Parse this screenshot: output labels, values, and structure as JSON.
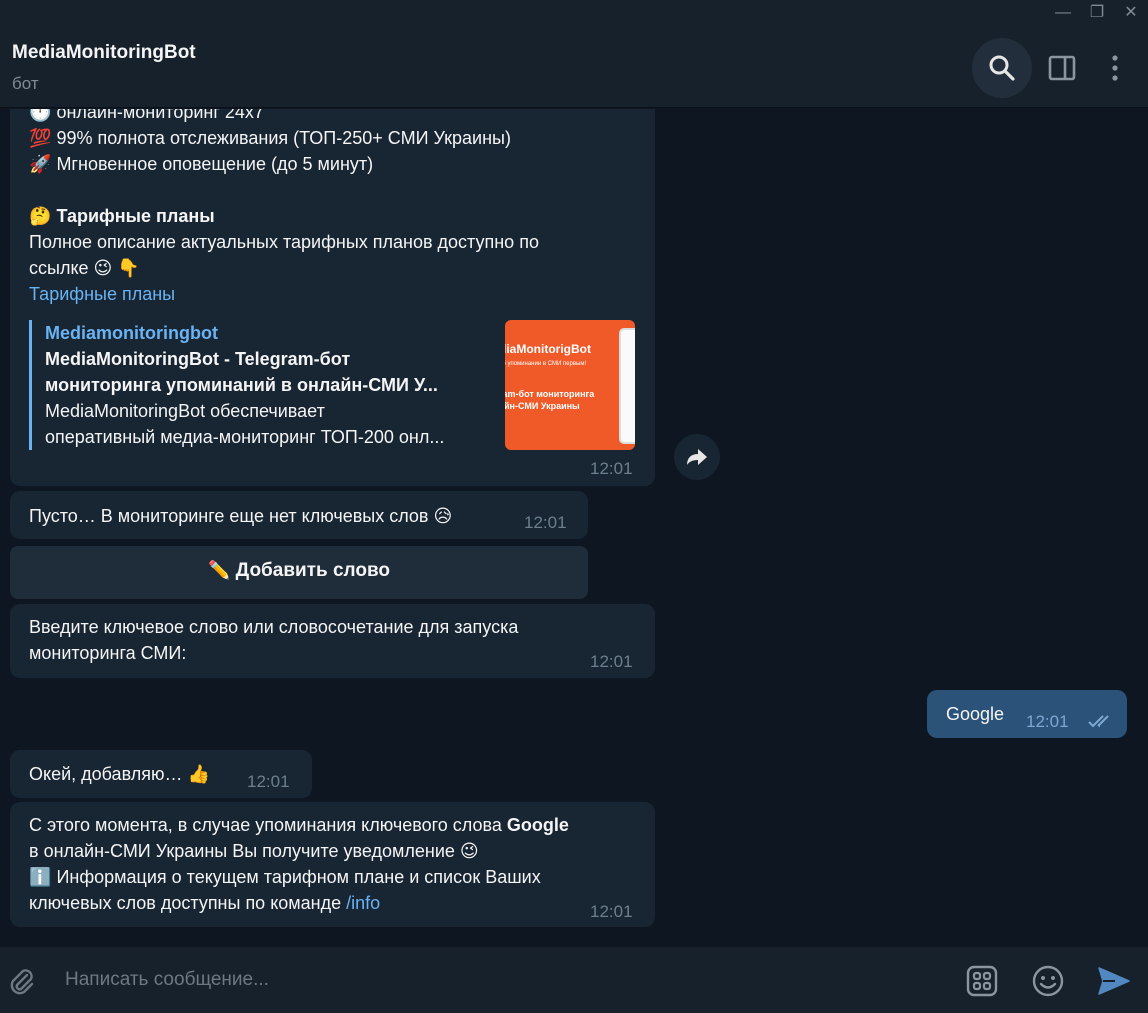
{
  "window": {
    "minimize_glyph": "—",
    "restore_glyph": "❐",
    "close_glyph": "✕"
  },
  "header": {
    "title": "MediaMonitoringBot",
    "subtitle": "бот",
    "icons": [
      "search-icon",
      "sidebar-toggle-icon",
      "more-vertical-icon"
    ]
  },
  "messages": {
    "m1": {
      "emoji_clock": "🕛",
      "line_partial": "онлайн-мониторинг 24x7",
      "emoji_100": "💯",
      "line_coverage": "99% полнота отслеживания (ТОП-250+ СМИ Украины)",
      "emoji_rocket": "🚀",
      "line_alert": "Мгновенное оповещение (до 5 минут)",
      "emoji_think": "🤔",
      "plans_heading": "Тарифные планы",
      "plans_desc_1": "Полное описание актуальных тарифных планов доступно по",
      "plans_desc_2": "ссылке",
      "emoji_wink": "😉",
      "emoji_point": "👇",
      "plans_link": "Тарифные планы",
      "preview": {
        "site": "Mediamonitoringbot",
        "title_1": "MediaMonitoringBot - Telegram-бот",
        "title_2": "мониторинга упоминаний  в онлайн-СМИ У...",
        "desc_1": "MediaMonitoringBot обеспечивает",
        "desc_2": "оперативный медиа-мониторинг ТОП-200 онл...",
        "image_text_1": "diaMonitorigBot",
        "image_text_2": "об упоминании в СМИ первым!",
        "image_text_3": "ram-бот мониторинга",
        "image_text_4": "айн-СМИ Украины"
      },
      "time": "12:01"
    },
    "m2": {
      "text": "Пусто… В мониторинге еще нет ключевых слов",
      "emoji": "😥",
      "time": "12:01"
    },
    "keyboard_button": {
      "emoji": "✏️",
      "label": "Добавить слово"
    },
    "m3": {
      "line_1": "Введите ключевое слово или словосочетание для запуска",
      "line_2": "мониторинга СМИ:",
      "time": "12:01"
    },
    "out1": {
      "text": "Google",
      "time": "12:01",
      "status_icon": "double-check-icon"
    },
    "m4": {
      "text": "Окей, добавляю…",
      "emoji": "👍",
      "time": "12:01"
    },
    "m5": {
      "line_1_a": "С этого момента, в случае упоминания ключевого слова ",
      "line_1_b": "Google",
      "line_2": "в онлайн-СМИ Украины Вы получите уведомление",
      "emoji_wink": "😉",
      "emoji_info": "ℹ️",
      "line_3": "Информация о текущем тарифном плане и список Ваших",
      "line_4": "ключевых слов доступны по команде ",
      "command": "/info",
      "time": "12:01"
    }
  },
  "composer": {
    "placeholder": "Написать сообщение...",
    "icons": [
      "attach-icon",
      "bot-commands-icon",
      "emoji-icon",
      "send-icon"
    ]
  },
  "colors": {
    "background": "#0e1621",
    "panel": "#17212b",
    "incoming_bubble": "#182533",
    "outgoing_bubble": "#2b5278",
    "link": "#6ab3f3",
    "accent_send": "#5288c1"
  }
}
